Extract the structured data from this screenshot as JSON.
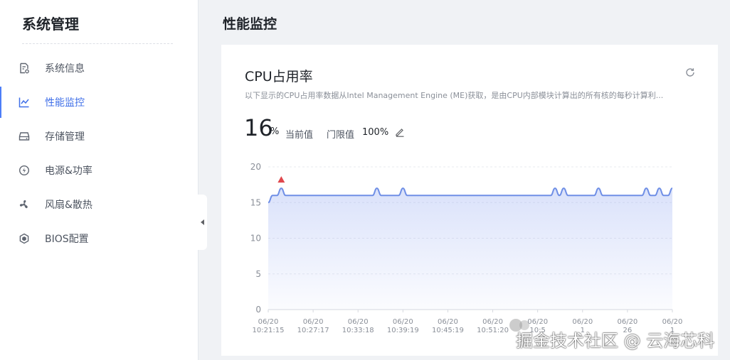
{
  "sidebar": {
    "title": "系统管理",
    "items": [
      {
        "label": "系统信息",
        "icon": "document-settings-icon"
      },
      {
        "label": "性能监控",
        "icon": "line-chart-icon",
        "active": true
      },
      {
        "label": "存储管理",
        "icon": "storage-drive-icon"
      },
      {
        "label": "电源&功率",
        "icon": "power-icon"
      },
      {
        "label": "风扇&散热",
        "icon": "fan-icon"
      },
      {
        "label": "BIOS配置",
        "icon": "hexagon-chip-icon"
      }
    ]
  },
  "main": {
    "title": "性能监控",
    "card": {
      "title": "CPU占用率",
      "description": "以下显示的CPU占用率数据从Intel Management Engine (ME)获取，是由CPU内部模块计算出的所有核的每秒计算利...",
      "current_value": "16",
      "current_unit": "%",
      "current_label": "当前值",
      "threshold_label": "门限值",
      "threshold_value": "100%"
    }
  },
  "colors": {
    "accent": "#4d7ef7",
    "line": "#6f8fe6",
    "marker": "#e0474c"
  },
  "chart_data": {
    "type": "area",
    "ylim": [
      0,
      20
    ],
    "yticks": [
      0,
      5,
      10,
      15,
      20
    ],
    "grid": true,
    "x_labels": [
      [
        "06/20",
        "10:21:15"
      ],
      [
        "06/20",
        "10:27:17"
      ],
      [
        "06/20",
        "10:33:18"
      ],
      [
        "06/20",
        "10:39:19"
      ],
      [
        "06/20",
        "10:45:19"
      ],
      [
        "06/20",
        "10:51:20"
      ],
      [
        "06/20",
        "10:5"
      ],
      [
        "06/20",
        "1"
      ],
      [
        "06/20",
        "26"
      ],
      [
        "06/20",
        "1"
      ]
    ],
    "values": [
      15,
      16,
      16,
      17,
      16,
      16,
      16,
      16,
      16,
      16,
      16,
      16,
      16,
      16,
      16,
      16,
      16,
      16,
      16,
      16,
      16,
      16,
      16,
      16,
      16,
      17,
      16,
      16,
      16,
      16,
      16,
      17,
      16,
      16,
      16,
      16,
      16,
      16,
      16,
      16,
      16,
      16,
      16,
      16,
      16,
      16,
      16,
      16,
      16,
      16,
      16,
      16,
      16,
      16,
      16,
      16,
      16,
      16,
      16,
      16,
      16,
      16,
      16,
      16,
      16,
      16,
      17,
      16,
      17,
      16,
      16,
      16,
      16,
      16,
      16,
      16,
      17,
      16,
      16,
      16,
      16,
      16,
      16,
      16,
      16,
      16,
      16,
      17,
      16,
      16,
      17,
      16,
      16,
      17
    ],
    "max_marker_index": 3
  },
  "watermark": "掘金技术社区 @ 云海芯科"
}
